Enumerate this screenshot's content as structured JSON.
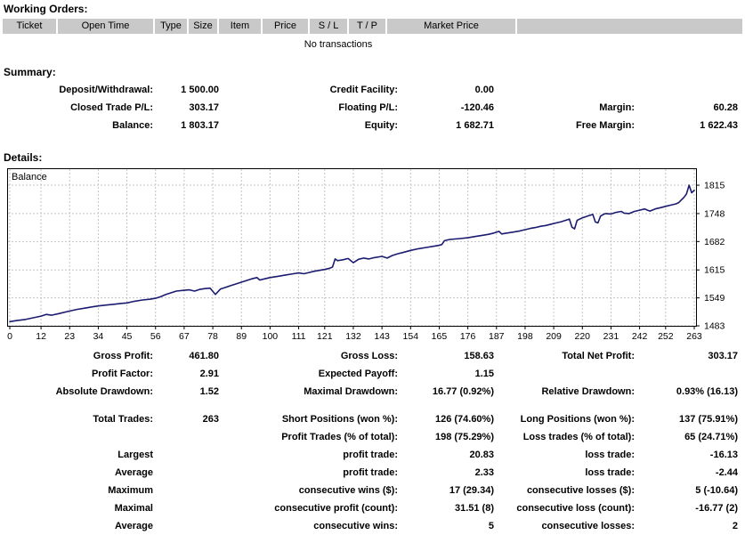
{
  "working_orders": {
    "title": "Working Orders:",
    "columns": [
      "Ticket",
      "Open Time",
      "Type",
      "Size",
      "Item",
      "Price",
      "S / L",
      "T / P",
      "Market Price",
      ""
    ],
    "empty_message": "No transactions"
  },
  "summary": {
    "title": "Summary:",
    "rows": [
      {
        "cells": [
          [
            "Deposit/Withdrawal:",
            "1 500.00"
          ],
          [
            "Credit Facility:",
            "0.00"
          ],
          [
            "",
            ""
          ]
        ]
      },
      {
        "cells": [
          [
            "Closed Trade P/L:",
            "303.17"
          ],
          [
            "Floating P/L:",
            "-120.46"
          ],
          [
            "Margin:",
            "60.28"
          ]
        ]
      },
      {
        "cells": [
          [
            "Balance:",
            "1 803.17"
          ],
          [
            "Equity:",
            "1 682.71"
          ],
          [
            "Free Margin:",
            "1 622.43"
          ]
        ]
      }
    ]
  },
  "details": {
    "title": "Details:",
    "rows": [
      {
        "cells": [
          [
            "Gross Profit:",
            "461.80"
          ],
          [
            "Gross Loss:",
            "158.63"
          ],
          [
            "Total Net Profit:",
            "303.17"
          ]
        ]
      },
      {
        "cells": [
          [
            "Profit Factor:",
            "2.91"
          ],
          [
            "Expected Payoff:",
            "1.15"
          ],
          [
            "",
            ""
          ]
        ]
      },
      {
        "cells": [
          [
            "Absolute Drawdown:",
            "1.52"
          ],
          [
            "Maximal Drawdown:",
            "16.77 (0.92%)"
          ],
          [
            "Relative Drawdown:",
            "0.93% (16.13)"
          ]
        ],
        "gap_after": true
      },
      {
        "cells": [
          [
            "Total Trades:",
            "263"
          ],
          [
            "Short Positions (won %):",
            "126 (74.60%)"
          ],
          [
            "Long Positions (won %):",
            "137 (75.91%)"
          ]
        ]
      },
      {
        "cells": [
          [
            "",
            ""
          ],
          [
            "Profit Trades (% of total):",
            "198 (75.29%)"
          ],
          [
            "Loss trades (% of total):",
            "65 (24.71%)"
          ]
        ]
      },
      {
        "cells": [
          [
            "Largest",
            ""
          ],
          [
            "profit trade:",
            "20.83"
          ],
          [
            "loss trade:",
            "-16.13"
          ]
        ]
      },
      {
        "cells": [
          [
            "Average",
            ""
          ],
          [
            "profit trade:",
            "2.33"
          ],
          [
            "loss trade:",
            "-2.44"
          ]
        ]
      },
      {
        "cells": [
          [
            "Maximum",
            ""
          ],
          [
            "consecutive wins ($):",
            "17 (29.34)"
          ],
          [
            "consecutive losses ($):",
            "5 (-10.64)"
          ]
        ]
      },
      {
        "cells": [
          [
            "Maximal",
            ""
          ],
          [
            "consecutive profit (count):",
            "31.51 (8)"
          ],
          [
            "consecutive loss (count):",
            "-16.77 (2)"
          ]
        ]
      },
      {
        "cells": [
          [
            "Average",
            ""
          ],
          [
            "consecutive wins:",
            "5"
          ],
          [
            "consecutive losses:",
            "2"
          ]
        ]
      }
    ]
  },
  "chart_data": {
    "type": "line",
    "title": "Balance",
    "xlabel": "",
    "ylabel": "",
    "x_range": [
      0,
      263
    ],
    "y_range": [
      1481,
      1855
    ],
    "x_ticks": [
      0,
      12,
      23,
      34,
      45,
      56,
      67,
      78,
      89,
      100,
      111,
      121,
      132,
      143,
      154,
      165,
      176,
      187,
      198,
      209,
      220,
      231,
      242,
      252,
      263
    ],
    "y_ticks": [
      1483,
      1549,
      1615,
      1682,
      1748,
      1815
    ],
    "grid": true,
    "grid_color": "#c4c4c4",
    "line_color": "#1b1b70",
    "legend_position": "top-left-inside",
    "series": [
      {
        "name": "Balance",
        "color": "#1b1b70",
        "points": [
          [
            0,
            1493
          ],
          [
            3,
            1496
          ],
          [
            6,
            1498
          ],
          [
            9,
            1502
          ],
          [
            12,
            1506
          ],
          [
            14,
            1510
          ],
          [
            16,
            1508
          ],
          [
            19,
            1512
          ],
          [
            23,
            1518
          ],
          [
            26,
            1522
          ],
          [
            29,
            1525
          ],
          [
            32,
            1528
          ],
          [
            34,
            1530
          ],
          [
            37,
            1532
          ],
          [
            40,
            1534
          ],
          [
            43,
            1536
          ],
          [
            45,
            1537
          ],
          [
            48,
            1541
          ],
          [
            51,
            1544
          ],
          [
            54,
            1546
          ],
          [
            56,
            1548
          ],
          [
            58,
            1552
          ],
          [
            60,
            1557
          ],
          [
            62,
            1561
          ],
          [
            64,
            1565
          ],
          [
            67,
            1567
          ],
          [
            69,
            1568
          ],
          [
            71,
            1565
          ],
          [
            73,
            1569
          ],
          [
            75,
            1571
          ],
          [
            77,
            1572
          ],
          [
            79,
            1557
          ],
          [
            81,
            1570
          ],
          [
            83,
            1574
          ],
          [
            85,
            1578
          ],
          [
            87,
            1582
          ],
          [
            89,
            1586
          ],
          [
            91,
            1590
          ],
          [
            93,
            1594
          ],
          [
            95,
            1597
          ],
          [
            96,
            1591
          ],
          [
            98,
            1594
          ],
          [
            100,
            1597
          ],
          [
            103,
            1600
          ],
          [
            106,
            1603
          ],
          [
            109,
            1606
          ],
          [
            111,
            1608
          ],
          [
            113,
            1606
          ],
          [
            115,
            1609
          ],
          [
            117,
            1612
          ],
          [
            119,
            1614
          ],
          [
            121,
            1616
          ],
          [
            123,
            1619
          ],
          [
            124,
            1622
          ],
          [
            125,
            1641
          ],
          [
            126,
            1637
          ],
          [
            128,
            1639
          ],
          [
            130,
            1642
          ],
          [
            132,
            1632
          ],
          [
            134,
            1640
          ],
          [
            136,
            1643
          ],
          [
            138,
            1641
          ],
          [
            140,
            1644
          ],
          [
            142,
            1646
          ],
          [
            143,
            1647
          ],
          [
            145,
            1643
          ],
          [
            147,
            1649
          ],
          [
            149,
            1653
          ],
          [
            151,
            1656
          ],
          [
            154,
            1661
          ],
          [
            157,
            1665
          ],
          [
            160,
            1668
          ],
          [
            163,
            1671
          ],
          [
            165,
            1673
          ],
          [
            166,
            1675
          ],
          [
            167,
            1684
          ],
          [
            169,
            1687
          ],
          [
            171,
            1688
          ],
          [
            173,
            1689
          ],
          [
            176,
            1691
          ],
          [
            179,
            1694
          ],
          [
            182,
            1697
          ],
          [
            184,
            1699
          ],
          [
            186,
            1702
          ],
          [
            188,
            1706
          ],
          [
            189,
            1700
          ],
          [
            191,
            1702
          ],
          [
            193,
            1704
          ],
          [
            196,
            1707
          ],
          [
            198,
            1710
          ],
          [
            200,
            1713
          ],
          [
            202,
            1715
          ],
          [
            204,
            1718
          ],
          [
            206,
            1720
          ],
          [
            208,
            1723
          ],
          [
            210,
            1726
          ],
          [
            212,
            1729
          ],
          [
            213,
            1731
          ],
          [
            214,
            1733
          ],
          [
            215,
            1735
          ],
          [
            216,
            1716
          ],
          [
            217,
            1712
          ],
          [
            218,
            1732
          ],
          [
            220,
            1738
          ],
          [
            222,
            1742
          ],
          [
            223,
            1744
          ],
          [
            224,
            1746
          ],
          [
            225,
            1728
          ],
          [
            226,
            1726
          ],
          [
            227,
            1742
          ],
          [
            228,
            1746
          ],
          [
            229,
            1748
          ],
          [
            231,
            1747
          ],
          [
            233,
            1751
          ],
          [
            235,
            1753
          ],
          [
            236,
            1749
          ],
          [
            238,
            1748
          ],
          [
            240,
            1753
          ],
          [
            242,
            1756
          ],
          [
            244,
            1759
          ],
          [
            245,
            1756
          ],
          [
            246,
            1754
          ],
          [
            248,
            1759
          ],
          [
            250,
            1762
          ],
          [
            252,
            1765
          ],
          [
            254,
            1768
          ],
          [
            256,
            1771
          ],
          [
            257,
            1774
          ],
          [
            258,
            1780
          ],
          [
            259,
            1786
          ],
          [
            260,
            1794
          ],
          [
            261,
            1815
          ],
          [
            262,
            1797
          ],
          [
            263,
            1803
          ]
        ]
      }
    ]
  }
}
